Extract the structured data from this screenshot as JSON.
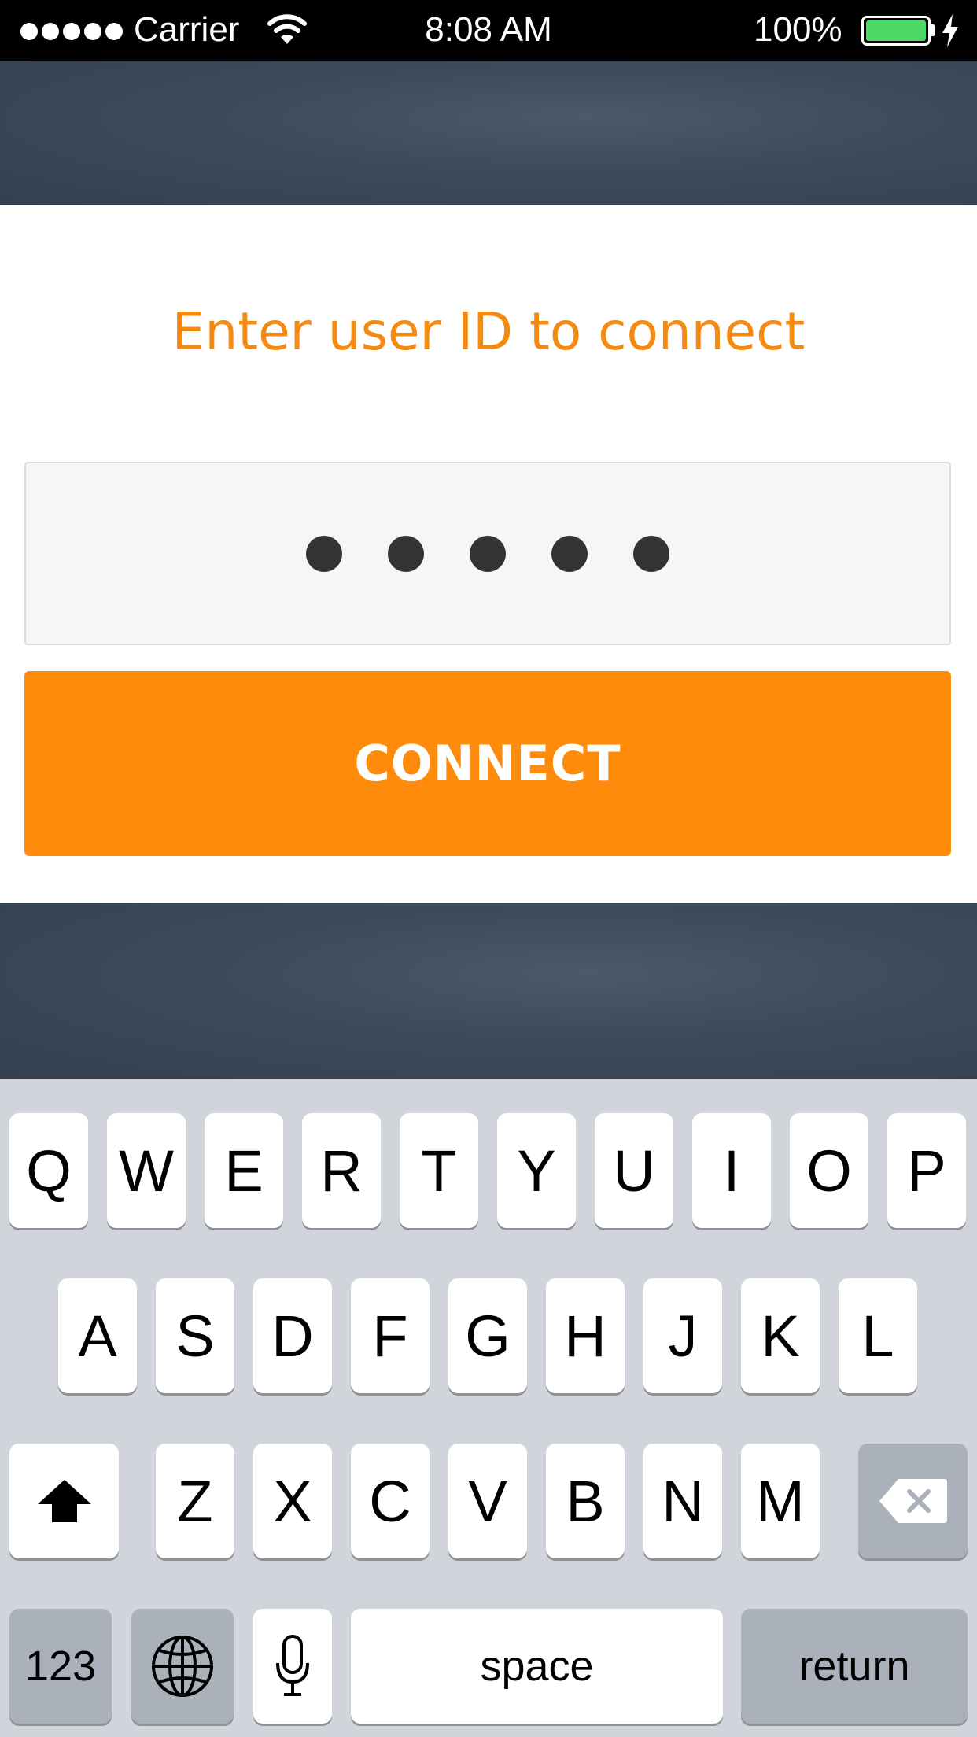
{
  "status_bar": {
    "carrier": "Carrier",
    "time": "8:08 AM",
    "battery": "100%",
    "battery_color": "#4cd964",
    "icons": [
      "signal-dots-icon",
      "wifi-icon",
      "battery-icon",
      "charging-bolt-icon"
    ]
  },
  "connect": {
    "prompt": "Enter user ID to connect",
    "masked_value": "•••••",
    "button_label": "CONNECT",
    "accent_color": "#fe8b0b"
  },
  "keyboard": {
    "row1": [
      "Q",
      "W",
      "E",
      "R",
      "T",
      "Y",
      "U",
      "I",
      "O",
      "P"
    ],
    "row2": [
      "A",
      "S",
      "D",
      "F",
      "G",
      "H",
      "J",
      "K",
      "L"
    ],
    "row3": [
      "Z",
      "X",
      "C",
      "V",
      "B",
      "N",
      "M"
    ],
    "numbers_label": "123",
    "space_label": "space",
    "return_label": "return",
    "icons": [
      "shift-icon",
      "backspace-icon",
      "globe-icon",
      "microphone-icon"
    ]
  }
}
